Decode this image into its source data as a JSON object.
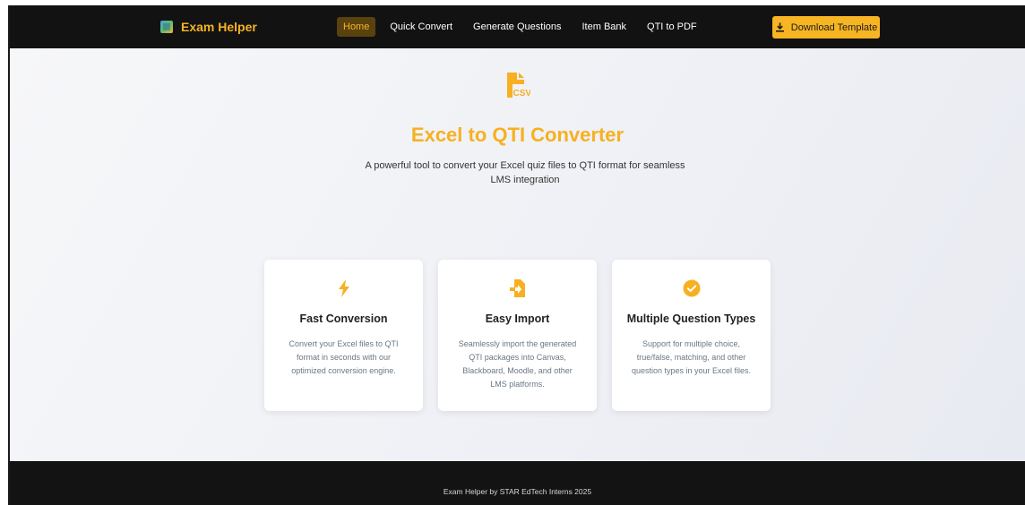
{
  "navbar": {
    "brand": "Exam Helper",
    "links": [
      {
        "label": "Home",
        "active": true
      },
      {
        "label": "Quick Convert"
      },
      {
        "label": "Generate Questions"
      },
      {
        "label": "Item Bank"
      },
      {
        "label": "QTI to PDF"
      }
    ],
    "download_label": "Download Template"
  },
  "hero": {
    "icon": "csv-file-icon",
    "title": "Excel to QTI Converter",
    "subtitle": "A powerful tool to convert your Excel quiz files to QTI format for seamless LMS integration"
  },
  "features": [
    {
      "icon": "lightning-bolt-icon",
      "title": "Fast Conversion",
      "text": "Convert your Excel files to QTI format in seconds with our optimized conversion engine."
    },
    {
      "icon": "file-import-icon",
      "title": "Easy Import",
      "text": "Seamlessly import the generated QTI packages into Canvas, Blackboard, Moodle, and other LMS platforms."
    },
    {
      "icon": "check-circle-icon",
      "title": "Multiple Question Types",
      "text": "Support for multiple choice, true/false, matching, and other question types in your Excel files."
    }
  ],
  "footer": {
    "text": "Exam Helper by STAR EdTech Interns 2025"
  },
  "colors": {
    "accent": "#f7b423",
    "navbar_bg": "#121212",
    "footer_bg": "#131313"
  }
}
